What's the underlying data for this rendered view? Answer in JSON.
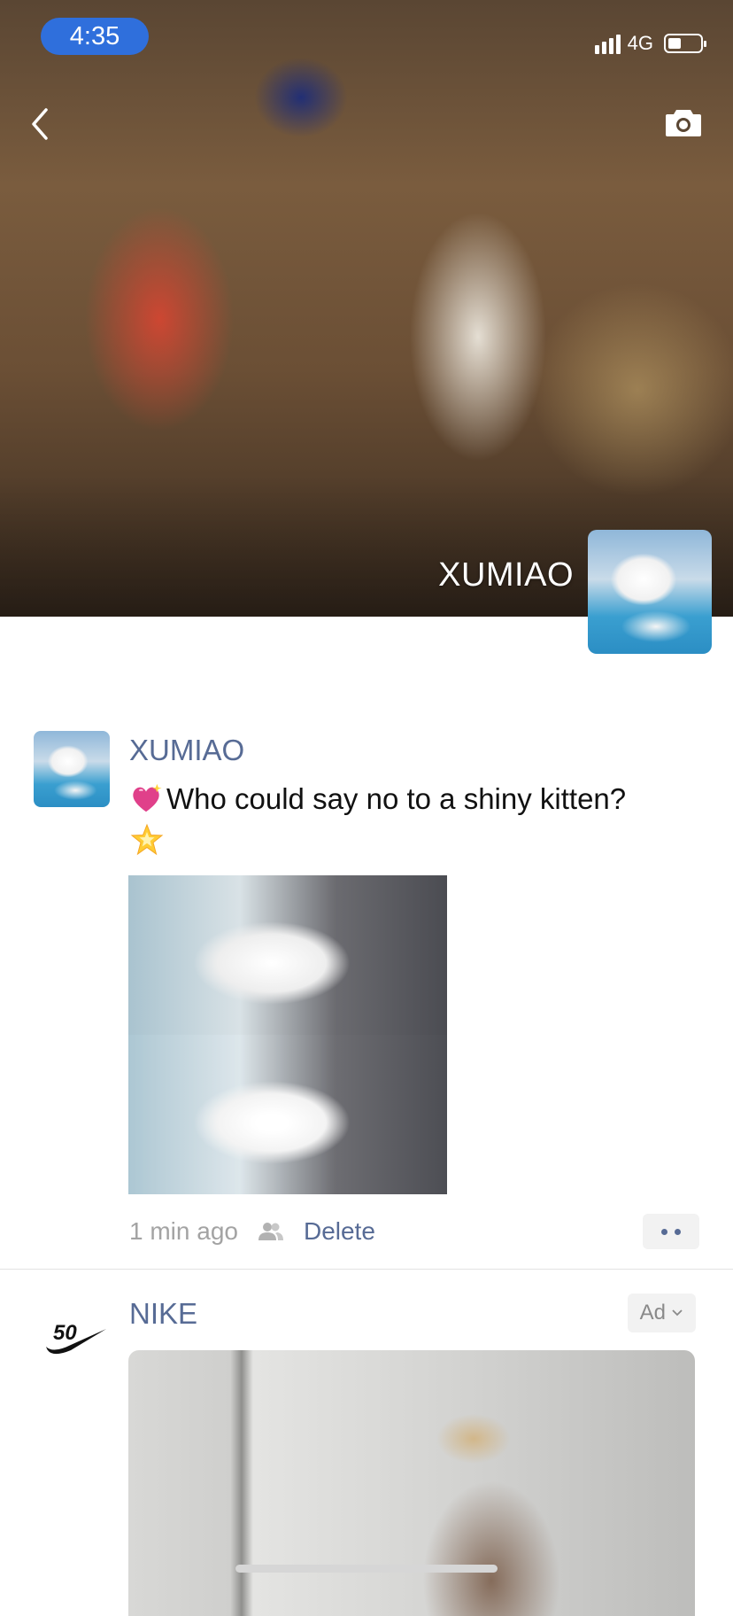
{
  "status_bar": {
    "time": "4:35",
    "network": "4G",
    "battery_level": 0.45
  },
  "cover": {
    "user_name": "XUMIAO"
  },
  "post": {
    "author": "XUMIAO",
    "text": "Who could say no to a shiny kitten?",
    "emoji_before": "sparkling-heart",
    "emoji_after": "glowing-star",
    "time": "1 min ago",
    "delete_label": "Delete"
  },
  "ad": {
    "brand": "NIKE",
    "logo_text": "50",
    "badge": "Ad"
  },
  "colors": {
    "link": "#576b95",
    "time_pill": "#2f6fdc",
    "meta_grey": "#a3a3a3"
  }
}
